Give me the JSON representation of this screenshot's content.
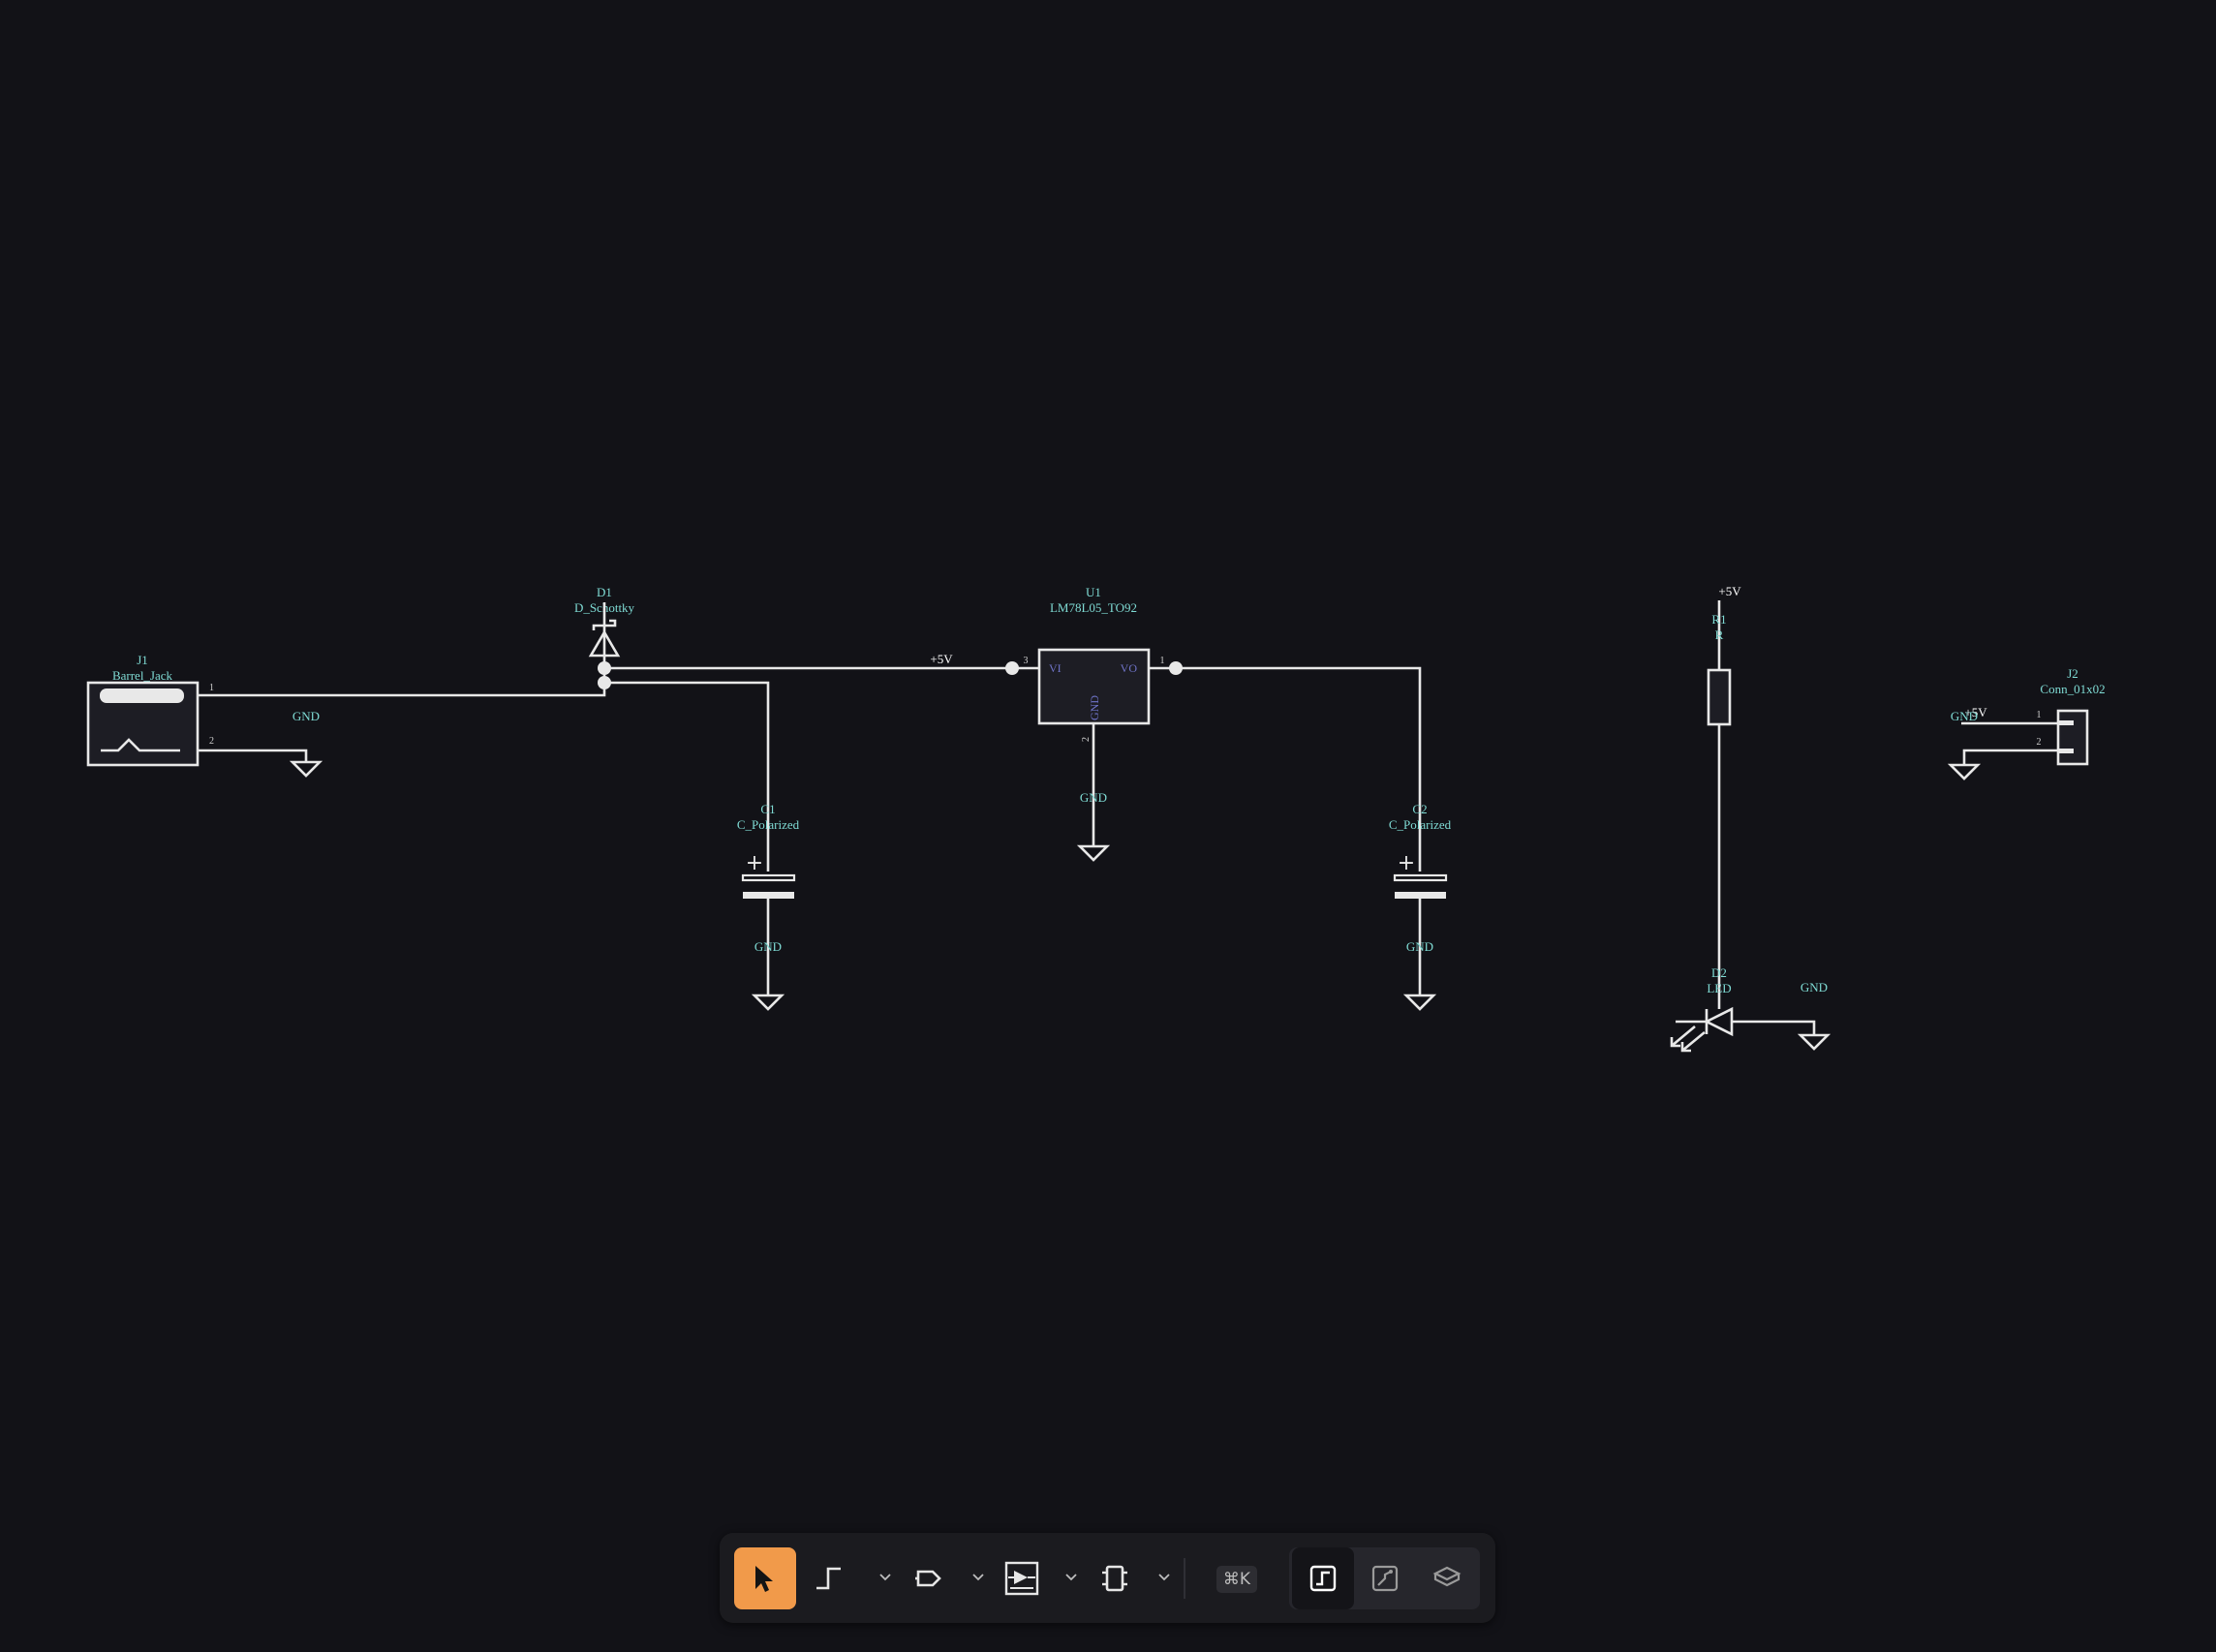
{
  "schematic": {
    "components": {
      "J1": {
        "ref": "J1",
        "value": "Barrel_Jack",
        "pins": [
          "1",
          "2"
        ]
      },
      "D1": {
        "ref": "D1",
        "value": "D_Schottky"
      },
      "U1": {
        "ref": "U1",
        "value": "LM78L05_TO92",
        "pins": [
          "3",
          "1",
          "2"
        ],
        "pin_names": [
          "VI",
          "VO",
          "GND"
        ]
      },
      "C1": {
        "ref": "C1",
        "value": "C_Polarized",
        "polarity": "+"
      },
      "C2": {
        "ref": "C2",
        "value": "C_Polarized",
        "polarity": "+"
      },
      "R1": {
        "ref": "R1",
        "value": "R"
      },
      "D2": {
        "ref": "D2",
        "value": "LED"
      },
      "J2": {
        "ref": "J2",
        "value": "Conn_01x02",
        "pins": [
          "1",
          "2"
        ]
      }
    },
    "net_labels": {
      "vcc": "+5V",
      "gnd": "GND"
    }
  },
  "toolbar": {
    "tools": [
      {
        "name": "select",
        "icon": "cursor-arrow-icon",
        "active": true
      },
      {
        "name": "wire",
        "icon": "wire-icon",
        "has_menu": true
      },
      {
        "name": "net-label",
        "icon": "net-label-icon",
        "has_menu": true
      },
      {
        "name": "component",
        "icon": "component-icon",
        "has_menu": true
      },
      {
        "name": "chip",
        "icon": "chip-icon",
        "has_menu": true
      }
    ],
    "shortcut": "⌘K",
    "views": [
      {
        "name": "schematic",
        "icon": "schematic-view-icon",
        "active": true
      },
      {
        "name": "pcb",
        "icon": "pcb-view-icon",
        "active": false
      },
      {
        "name": "3d",
        "icon": "3d-view-icon",
        "active": false
      }
    ]
  },
  "colors": {
    "background": "#121217",
    "wire": "#e8e8e8",
    "label": "#7fdbd4",
    "pin_name": "#6f74c9",
    "accent": "#f19a4a",
    "toolbar": "#1b1b1f"
  }
}
